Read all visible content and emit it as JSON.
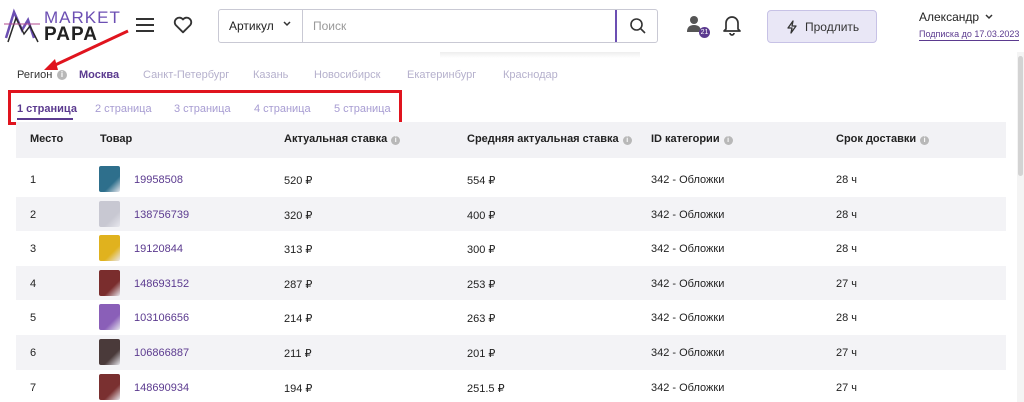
{
  "brand": {
    "line1": "MARKET",
    "line2": "PAPA"
  },
  "search": {
    "filter_label": "Артикул",
    "placeholder": "Поиск"
  },
  "header": {
    "badge_count": "21",
    "extend_label": "Продлить",
    "user_name": "Александр",
    "subscription": "Подписка до 17.03.2023"
  },
  "regions": {
    "label": "Регион",
    "items": [
      "Москва",
      "Санкт-Петербург",
      "Казань",
      "Новосибирск",
      "Екатеринбург",
      "Краснодар"
    ],
    "active": "Москва"
  },
  "tabs": {
    "items": [
      "1 страница",
      "2 страница",
      "3 страница",
      "4 страница",
      "5 страница"
    ],
    "active": "1 страница"
  },
  "table": {
    "headers": [
      "Место",
      "Товар",
      "Актуальная ставка",
      "Средняя актуальная ставка",
      "ID категории",
      "Срок доставки"
    ],
    "rows": [
      {
        "place": "1",
        "product": "19958508",
        "bid": "520 ₽",
        "avg_bid": "554 ₽",
        "category": "342 - Обложки",
        "delivery": "28 ч",
        "thumb": "#2e6f8c"
      },
      {
        "place": "2",
        "product": "138756739",
        "bid": "320 ₽",
        "avg_bid": "400 ₽",
        "category": "342 - Обложки",
        "delivery": "28 ч",
        "thumb": "#c8c8d2"
      },
      {
        "place": "3",
        "product": "19120844",
        "bid": "313 ₽",
        "avg_bid": "300 ₽",
        "category": "342 - Обложки",
        "delivery": "28 ч",
        "thumb": "#e0b21e"
      },
      {
        "place": "4",
        "product": "148693152",
        "bid": "287 ₽",
        "avg_bid": "253 ₽",
        "category": "342 - Обложки",
        "delivery": "27 ч",
        "thumb": "#7a2d2d"
      },
      {
        "place": "5",
        "product": "103106656",
        "bid": "214 ₽",
        "avg_bid": "263 ₽",
        "category": "342 - Обложки",
        "delivery": "28 ч",
        "thumb": "#8a5fb8"
      },
      {
        "place": "6",
        "product": "106866887",
        "bid": "211 ₽",
        "avg_bid": "201 ₽",
        "category": "342 - Обложки",
        "delivery": "27 ч",
        "thumb": "#4a3a3a"
      },
      {
        "place": "7",
        "product": "148690934",
        "bid": "194 ₽",
        "avg_bid": "251.5 ₽",
        "category": "342 - Обложки",
        "delivery": "27 ч",
        "thumb": "#7a3030"
      }
    ]
  },
  "colors": {
    "accent": "#5b3a8f",
    "highlight": "#e0141e",
    "muted": "#a79cd2"
  }
}
